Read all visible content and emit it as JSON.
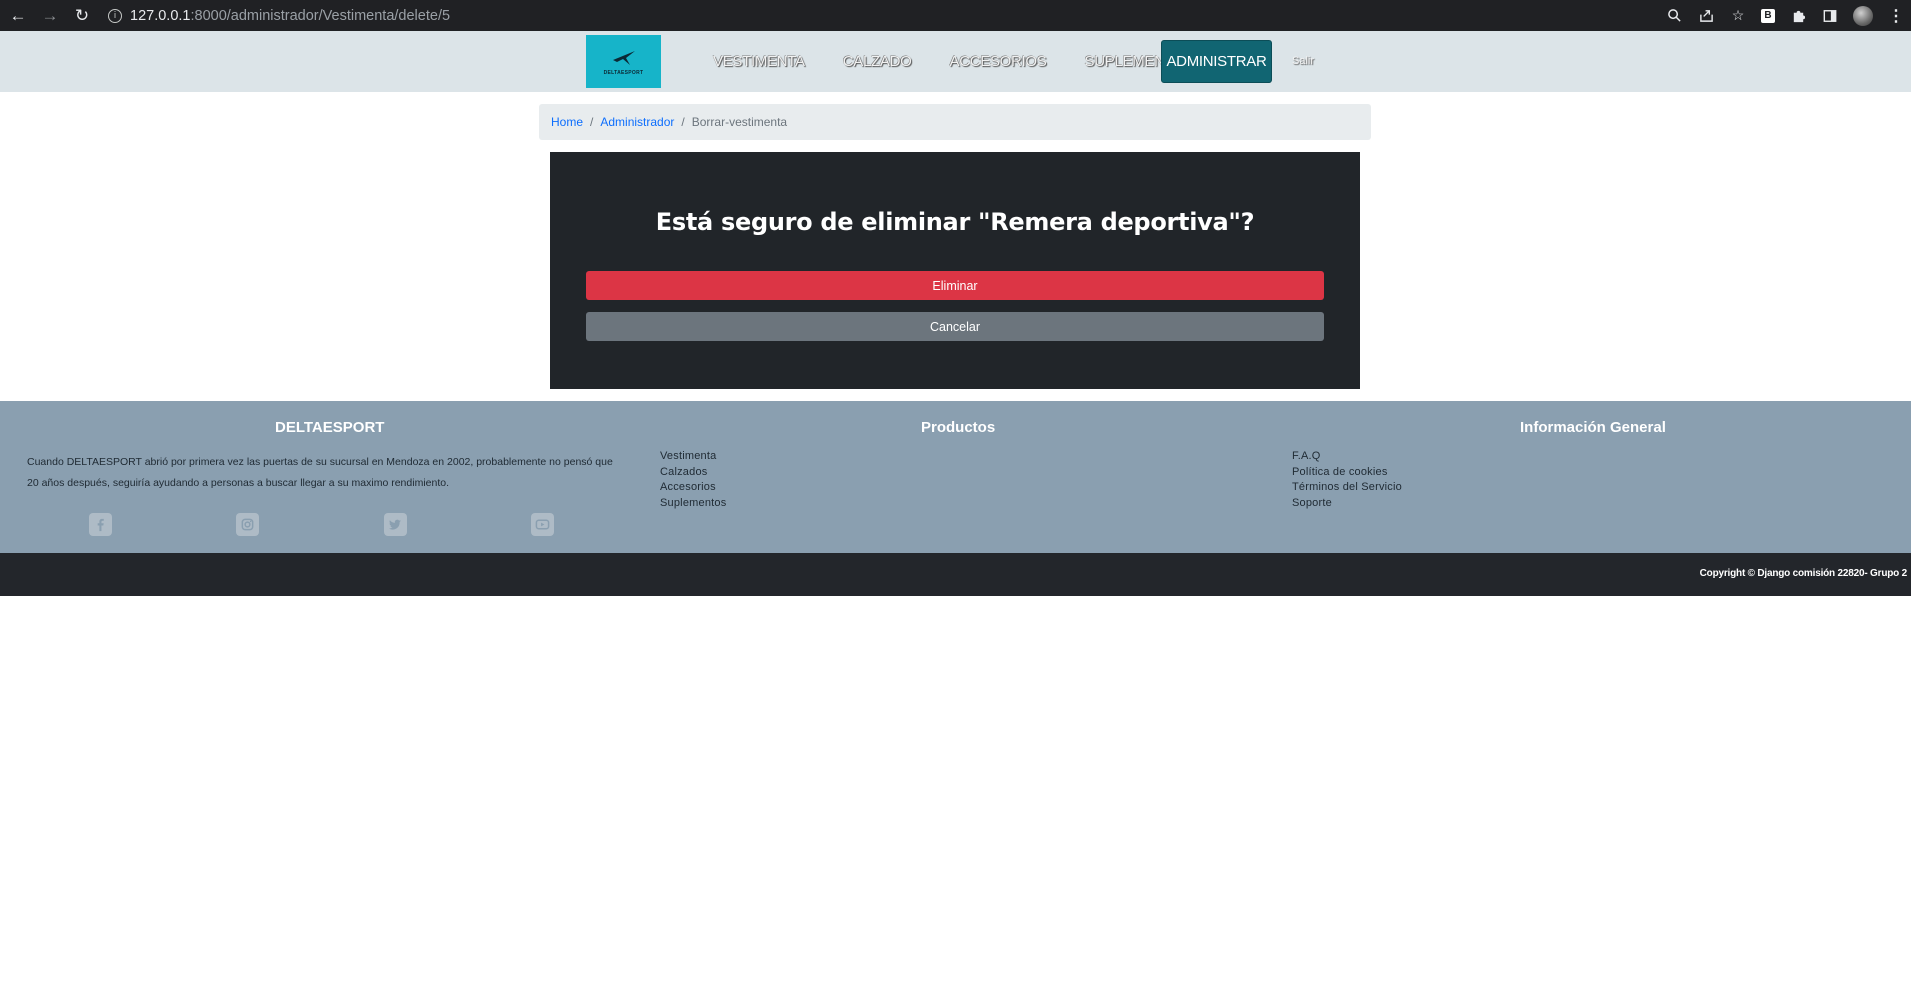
{
  "browser": {
    "url_host": "127.0.0.1",
    "url_path": ":8000/administrador/Vestimenta/delete/5",
    "extension_badge": "B"
  },
  "navbar": {
    "logo_text": "DELTAESPORT",
    "links": [
      "VESTIMENTA",
      "CALZADO",
      "ACCESORIOS",
      "SUPLEMENTOS"
    ],
    "admin_label": "ADMINISTRAR",
    "logout_label": "Salir"
  },
  "breadcrumb": {
    "home": "Home",
    "admin": "Administrador",
    "current": "Borrar-vestimenta",
    "separator": "/"
  },
  "dialog": {
    "question": "Está seguro de eliminar \"Remera deportiva\"?",
    "delete_label": "Eliminar",
    "cancel_label": "Cancelar"
  },
  "footer": {
    "about": {
      "title": "DELTAESPORT",
      "text": "Cuando DELTAESPORT abrió por primera vez las puertas de su sucursal en Mendoza en 2002, probablemente no pensó que 20 años después, seguiría ayudando a personas a buscar llegar a su maximo rendimiento."
    },
    "products": {
      "title": "Productos",
      "items": [
        "Vestimenta",
        "Calzados",
        "Accesorios",
        "Suplementos"
      ]
    },
    "info": {
      "title": "Información General",
      "items": [
        "F.A.Q",
        "Política de cookies",
        "Términos del Servicio",
        "Soporte"
      ]
    },
    "social_icons": [
      "facebook-icon",
      "instagram-icon",
      "twitter-icon",
      "youtube-icon"
    ],
    "copyright": "Copyright © Django comisión 22820- Grupo 2"
  },
  "colors": {
    "danger": "#dc3545",
    "secondary": "#6c757d",
    "admin_button": "#116572",
    "logo_bg": "#16b4c9",
    "footer_bg": "#8a9fb0",
    "card_bg": "#212529"
  }
}
